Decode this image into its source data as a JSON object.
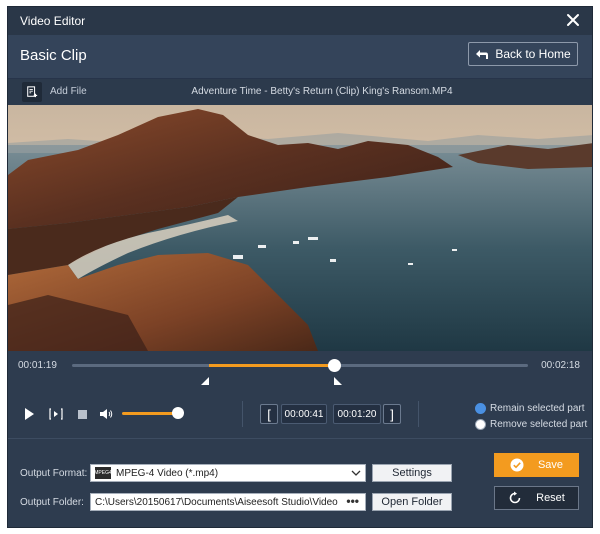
{
  "window": {
    "title": "Video Editor"
  },
  "header": {
    "page_title": "Basic Clip",
    "back_label": "Back to Home"
  },
  "filebar": {
    "add_file_label": "Add File",
    "file_name": "Adventure Time - Betty's Return (Clip) King's Ransom.MP4"
  },
  "timeline": {
    "current_time": "00:01:19",
    "total_time": "00:02:18",
    "selection_start_fraction": 0.3,
    "selection_end_fraction": 0.575
  },
  "controls": {
    "volume_fraction": 1.0,
    "start_time": "00:00:41",
    "end_time": "00:01:20",
    "radio_options": [
      {
        "label": "Remain selected part",
        "selected": true
      },
      {
        "label": "Remove selected part",
        "selected": false
      }
    ]
  },
  "output": {
    "format_label": "Output Format:",
    "format_value": "MPEG-4 Video (*.mp4)",
    "format_icon_text": "MPEG4",
    "settings_label": "Settings",
    "folder_label": "Output Folder:",
    "folder_value": "C:\\Users\\20150617\\Documents\\Aiseesoft Studio\\Video",
    "folder_dots": "•••",
    "open_folder_label": "Open Folder",
    "save_label": "Save",
    "reset_label": "Reset"
  },
  "colors": {
    "accent": "#f39b1f",
    "panel": "#2e3c4f",
    "radio_on": "#4a90e2"
  }
}
